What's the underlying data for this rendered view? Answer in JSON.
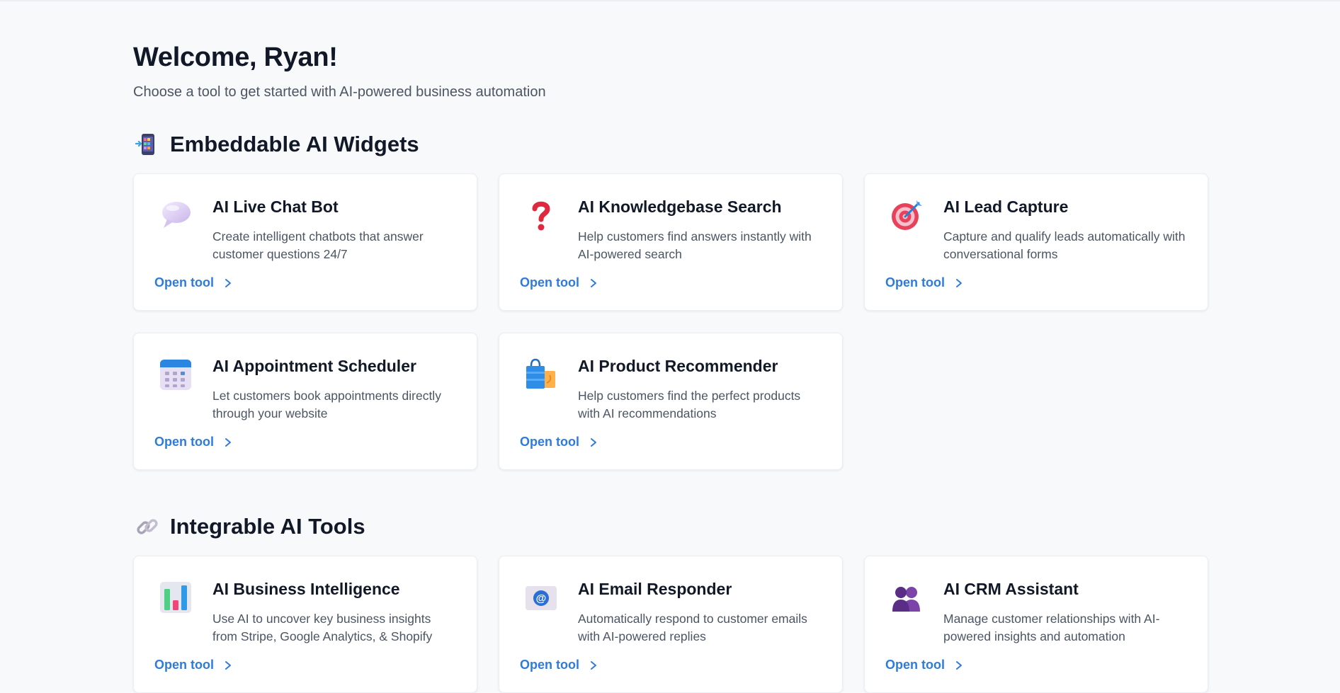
{
  "header": {
    "title": "Welcome, Ryan!",
    "subtitle": "Choose a tool to get started with AI-powered business automation"
  },
  "sections": [
    {
      "title": "Embeddable AI Widgets",
      "icon": "mobile-phone-icon",
      "cards": [
        {
          "title": "AI Live Chat Bot",
          "description": "Create intelligent chatbots that answer customer questions 24/7",
          "link": "Open tool",
          "icon": "speech-bubble-icon"
        },
        {
          "title": "AI Knowledgebase Search",
          "description": "Help customers find answers instantly with AI-powered search",
          "link": "Open tool",
          "icon": "question-mark-icon"
        },
        {
          "title": "AI Lead Capture",
          "description": "Capture and qualify leads automatically with conversational forms",
          "link": "Open tool",
          "icon": "target-icon"
        },
        {
          "title": "AI Appointment Scheduler",
          "description": "Let customers book appointments directly through your website",
          "link": "Open tool",
          "icon": "calendar-icon"
        },
        {
          "title": "AI Product Recommender",
          "description": "Help customers find the perfect products with AI recommendations",
          "link": "Open tool",
          "icon": "shopping-bags-icon"
        }
      ]
    },
    {
      "title": "Integrable AI Tools",
      "icon": "link-icon",
      "cards": [
        {
          "title": "AI Business Intelligence",
          "description": "Use AI to uncover key business insights from Stripe, Google Analytics, & Shopify",
          "link": "Open tool",
          "icon": "bar-chart-icon"
        },
        {
          "title": "AI Email Responder",
          "description": "Automatically respond to customer emails with AI-powered replies",
          "link": "Open tool",
          "icon": "email-icon"
        },
        {
          "title": "AI CRM Assistant",
          "description": "Manage customer relationships with AI-powered insights and automation",
          "link": "Open tool",
          "icon": "people-icon"
        }
      ]
    }
  ],
  "colors": {
    "background": "#f8f9fb",
    "link": "#2f7bd9",
    "heading": "#111827",
    "body_text": "#4b5563"
  }
}
